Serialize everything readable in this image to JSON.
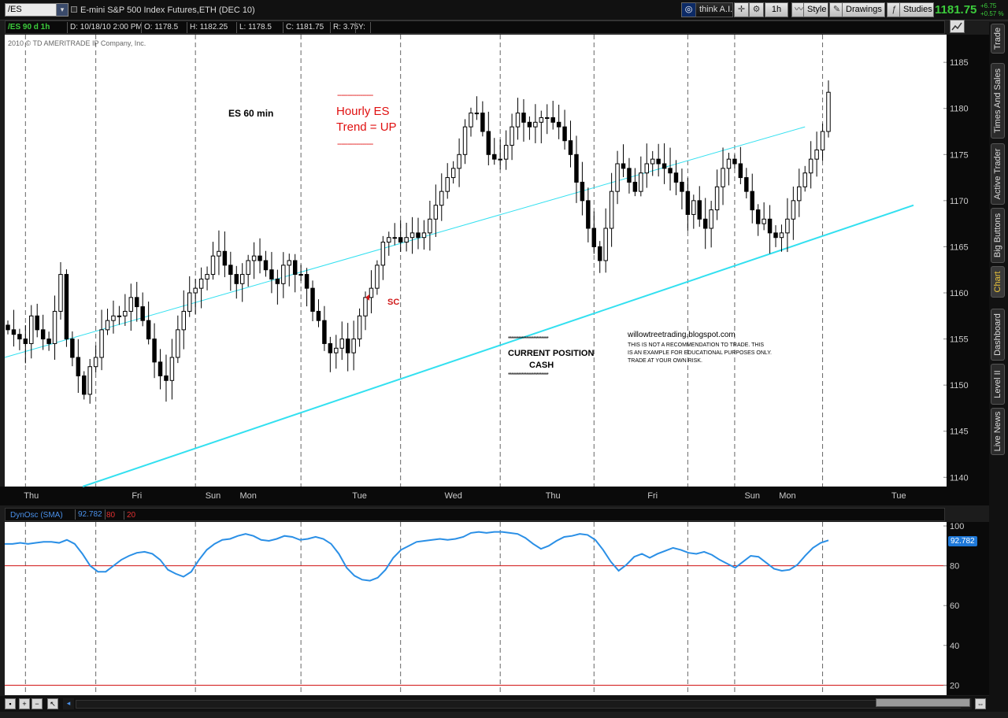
{
  "toolbar": {
    "symbol": "/ES",
    "description": "E-mini S&P 500 Index Futures,ETH (DEC 10)",
    "think_label": "think A.I.",
    "aggregation": "1h",
    "style_label": "Style",
    "drawings_label": "Drawings",
    "studies_label": "Studies",
    "last_price": "1181.75",
    "net_change": "+6.75",
    "pct_change": "+0.57 %"
  },
  "header": {
    "symbol_period": "/ES 90 d 1h",
    "date": "D: 10/18/10 2:00 PM",
    "open": "O: 1178.5",
    "high": "H: 1182.25",
    "low": "L: 1178.5",
    "close": "C: 1181.75",
    "range": "R: 3.75",
    "y": "Y:"
  },
  "sidebar": {
    "tabs": [
      "Trade",
      "Times And Sales",
      "Active Trader",
      "Big Buttons",
      "Chart",
      "Dashboard",
      "Level II",
      "Live News"
    ],
    "active": "Chart"
  },
  "annotations": {
    "copyright": "2010 © TD AMERITRADE IP Company, Inc.",
    "chart_label": "ES 60 min",
    "trend_dashes": "-----------------",
    "trend_line1": "Hourly ES",
    "trend_line2": "Trend = UP",
    "signal": "SC",
    "position_stars": "************************",
    "position_title": "CURRENT POSITION",
    "position_value": "CASH",
    "blog": "willowtreetrading.blogspot.com",
    "disclaimer1": "THIS IS NOT A RECOMMENDATION TO TRADE. THIS",
    "disclaimer2": "IS AN EXAMPLE FOR EDUCATIONAL PURPOSES ONLY.",
    "disclaimer3": "TRADE AT YOUR OWN RISK."
  },
  "oscillator": {
    "name": "DynOsc (SMA)",
    "value": "92.782",
    "upper": "80",
    "lower": "20"
  },
  "colors": {
    "candle": "#000000",
    "trendline": "#33e0f0",
    "osc_line": "#2a8fe6",
    "osc_levels": "#d01010",
    "last_price": "#3ccc3c",
    "signal": "#d01818"
  },
  "chart_data": [
    {
      "type": "candlestick",
      "title": "E-mini S&P 500 Index Futures,ETH (DEC 10)",
      "ylim": [
        1139,
        1188
      ],
      "y_ticks": [
        1140,
        1145,
        1150,
        1155,
        1160,
        1165,
        1170,
        1175,
        1180,
        1185
      ],
      "x_labels": [
        "Thu",
        "Fri",
        "Sun",
        "Mon",
        "Tue",
        "Wed",
        "Thu",
        "Fri",
        "Sun",
        "Mon",
        "Tue"
      ],
      "closes": [
        1156,
        1155.5,
        1155,
        1154.5,
        1157.5,
        1156,
        1155,
        1154.5,
        1158,
        1162,
        1155,
        1153,
        1151,
        1149,
        1152,
        1153,
        1156,
        1157,
        1157.5,
        1157.5,
        1158,
        1159.5,
        1158.5,
        1157,
        1155,
        1152.5,
        1151,
        1150.5,
        1153,
        1156,
        1158,
        1160,
        1160.5,
        1161.5,
        1162,
        1164,
        1164.5,
        1163,
        1162,
        1161,
        1162,
        1163.5,
        1164,
        1163.5,
        1162.5,
        1161.5,
        1161,
        1163,
        1163.5,
        1162,
        1162,
        1160.5,
        1158,
        1157,
        1154.5,
        1153.5,
        1154,
        1155,
        1153.5,
        1155,
        1157.5,
        1159.5,
        1160.5,
        1163,
        1165.5,
        1166,
        1166,
        1165.5,
        1166,
        1166.5,
        1166,
        1166.5,
        1168,
        1169.5,
        1171,
        1172.5,
        1173.5,
        1175,
        1178,
        1179.5,
        1179.5,
        1177.5,
        1175,
        1174.5,
        1174.5,
        1176,
        1178,
        1179.5,
        1178.5,
        1178,
        1178.5,
        1179,
        1179,
        1178.5,
        1178,
        1176.5,
        1175,
        1172,
        1170,
        1167,
        1165,
        1163.5,
        1167,
        1171,
        1174,
        1173.5,
        1172,
        1171,
        1173,
        1174,
        1174.5,
        1174,
        1173.5,
        1173,
        1172,
        1171,
        1168.5,
        1170,
        1168,
        1167,
        1169,
        1171.5,
        1173.5,
        1174.5,
        1174,
        1172.5,
        1171,
        1169,
        1167.5,
        1168,
        1166.5,
        1166,
        1166.5,
        1168,
        1170,
        1171.5,
        1173,
        1174.5,
        1175.5,
        1177.5,
        1181.75
      ]
    },
    {
      "type": "line",
      "series": [
        {
          "name": "DynOsc (SMA)"
        }
      ],
      "ylim": [
        15,
        102
      ],
      "y_ticks": [
        20,
        40,
        60,
        80,
        100
      ],
      "reference_lines": [
        80,
        20
      ],
      "values": [
        91,
        91,
        91.5,
        91,
        91.5,
        92,
        92,
        91.5,
        93,
        91,
        86,
        80,
        77,
        77,
        80,
        83,
        85,
        86.5,
        87,
        86,
        83,
        78,
        76,
        74.5,
        77,
        83,
        88,
        91,
        93,
        93.5,
        95,
        96,
        95,
        93,
        92.5,
        93.5,
        95,
        94.5,
        93,
        93.5,
        94.5,
        93.5,
        91,
        86,
        79,
        75,
        73,
        72.5,
        74,
        78,
        84,
        88,
        90,
        92,
        92.5,
        93,
        93.5,
        93,
        93.5,
        94.5,
        96.5,
        97,
        96.5,
        97,
        97,
        96.5,
        96,
        94,
        91,
        88.5,
        90,
        92.5,
        94.5,
        95,
        96,
        95.5,
        93,
        88,
        82,
        77.5,
        80.5,
        84.5,
        86,
        84,
        86,
        87.5,
        89,
        88,
        86.5,
        86,
        87,
        85.5,
        83,
        81,
        79,
        82,
        85,
        84.5,
        81.5,
        78.5,
        77.5,
        78,
        80.5,
        85,
        89,
        91.5,
        92.782
      ]
    }
  ]
}
